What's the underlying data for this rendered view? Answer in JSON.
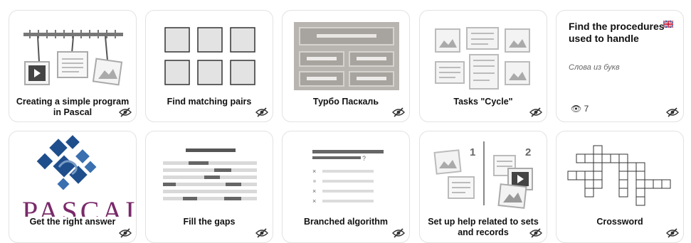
{
  "cards": [
    {
      "title": "Creating a simple program in Pascal",
      "icon": "eye-slash-icon"
    },
    {
      "title": "Find matching pairs",
      "icon": "eye-slash-icon"
    },
    {
      "title": "Турбо Паскаль",
      "icon": "eye-slash-icon"
    },
    {
      "title": "Tasks \"Cycle\"",
      "icon": "eye-slash-icon"
    },
    {
      "title": "Find the procedures used to handle",
      "subtitle": "Слова из букв",
      "views": "7",
      "flag": "uk-flag-icon",
      "icon": "eye-slash-icon"
    },
    {
      "title": "Get the right answer",
      "thumb_text": "PASCAL",
      "icon": "eye-slash-icon"
    },
    {
      "title": "Fill the gaps",
      "icon": "eye-slash-icon"
    },
    {
      "title": "Branched algorithm",
      "icon": "eye-slash-icon"
    },
    {
      "title": "Set up help related to sets and records",
      "step_numbers": [
        "1",
        "2"
      ],
      "icon": "eye-slash-icon"
    },
    {
      "title": "Crossword",
      "icon": "eye-slash-icon"
    }
  ],
  "colors": {
    "card_border": "#e2e2e2",
    "thumb_gray": "#b8b5b0",
    "thumb_dark": "#555555",
    "pascal_purple": "#7a2a6a",
    "pascal_blue": "#1f4e8c"
  }
}
